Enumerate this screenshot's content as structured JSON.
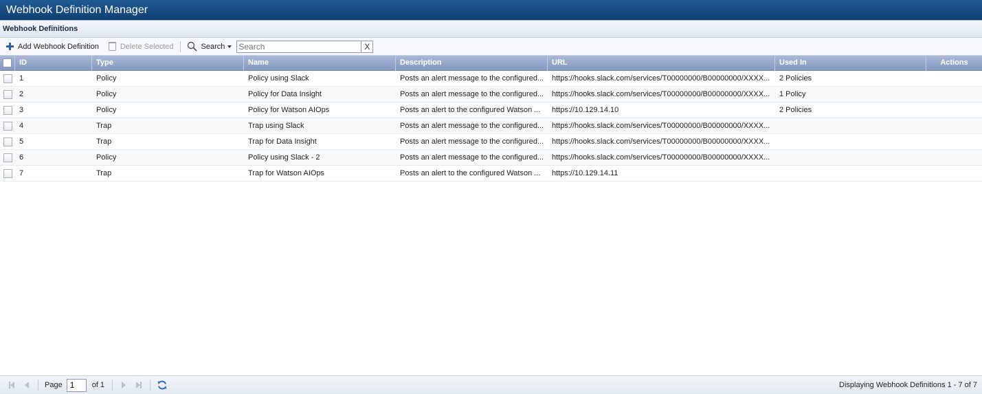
{
  "window": {
    "title": "Webhook Definition Manager"
  },
  "panel": {
    "title": "Webhook Definitions"
  },
  "toolbar": {
    "add_label": "Add Webhook Definition",
    "delete_label": "Delete Selected",
    "search_menu_label": "Search",
    "search_placeholder": "Search",
    "search_value": "",
    "clear_label": "X"
  },
  "grid": {
    "columns": {
      "id": "ID",
      "type": "Type",
      "name": "Name",
      "description": "Description",
      "url": "URL",
      "used_in": "Used In",
      "actions": "Actions"
    },
    "rows": [
      {
        "id": "1",
        "type": "Policy",
        "name": "Policy using Slack",
        "description": "Posts an alert message to the configured...",
        "url": "https://hooks.slack.com/services/T00000000/B00000000/XXXX...",
        "used_in": "2 Policies"
      },
      {
        "id": "2",
        "type": "Policy",
        "name": "Policy for Data Insight",
        "description": "Posts an alert message to the configured...",
        "url": "https://hooks.slack.com/services/T00000000/B00000000/XXXX...",
        "used_in": "1 Policy"
      },
      {
        "id": "3",
        "type": "Policy",
        "name": "Policy for Watson AIOps",
        "description": "Posts an alert to the configured Watson ...",
        "url": "https://10.129.14.10",
        "used_in": "2 Policies"
      },
      {
        "id": "4",
        "type": "Trap",
        "name": "Trap using Slack",
        "description": "Posts an alert message to the configured...",
        "url": "https://hooks.slack.com/services/T00000000/B00000000/XXXX...",
        "used_in": ""
      },
      {
        "id": "5",
        "type": "Trap",
        "name": "Trap for Data Insight",
        "description": "Posts an alert message to the configured...",
        "url": "https://hooks.slack.com/services/T00000000/B00000000/XXXX...",
        "used_in": ""
      },
      {
        "id": "6",
        "type": "Policy",
        "name": "Policy using Slack - 2",
        "description": "Posts an alert message to the configured...",
        "url": "https://hooks.slack.com/services/T00000000/B00000000/XXXX...",
        "used_in": ""
      },
      {
        "id": "7",
        "type": "Trap",
        "name": "Trap for Watson AIOps",
        "description": "Posts an alert to the configured Watson ...",
        "url": "https://10.129.14.11",
        "used_in": ""
      }
    ]
  },
  "pager": {
    "page_label": "Page",
    "current_page": "1",
    "of_label": "of 1",
    "status": "Displaying Webhook Definitions 1 - 7 of 7"
  },
  "icons": {
    "add": "plus-icon",
    "delete": "trash-icon",
    "search": "magnifier-icon",
    "first": "first-page-icon",
    "prev": "prev-page-icon",
    "next": "next-page-icon",
    "last": "last-page-icon",
    "refresh": "refresh-icon"
  },
  "colors": {
    "titlebar": "#0f3f72",
    "grid_header": "#8398c0",
    "accent": "#2a63a6"
  }
}
